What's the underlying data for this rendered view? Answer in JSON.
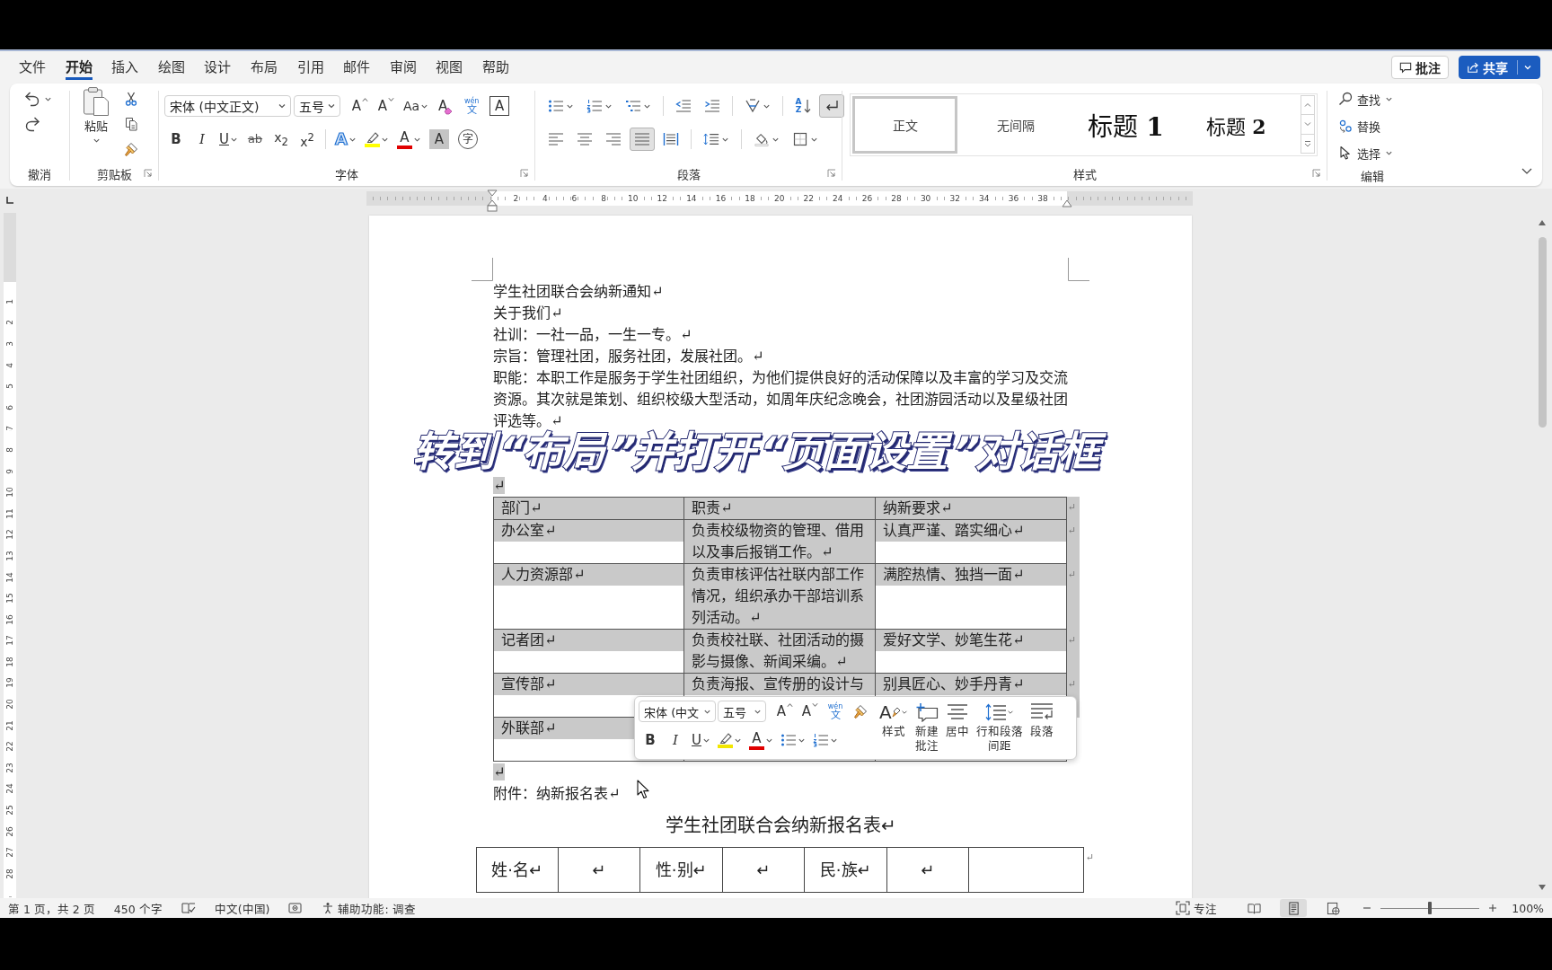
{
  "menu_tabs": [
    {
      "label": "文件",
      "selected": false
    },
    {
      "label": "开始",
      "selected": true
    },
    {
      "label": "插入",
      "selected": false
    },
    {
      "label": "绘图",
      "selected": false
    },
    {
      "label": "设计",
      "selected": false
    },
    {
      "label": "布局",
      "selected": false
    },
    {
      "label": "引用",
      "selected": false
    },
    {
      "label": "邮件",
      "selected": false
    },
    {
      "label": "审阅",
      "selected": false
    },
    {
      "label": "视图",
      "selected": false
    },
    {
      "label": "帮助",
      "selected": false
    }
  ],
  "header_buttons": [
    {
      "kind": "comments",
      "label": "批注"
    },
    {
      "kind": "share",
      "label": "共享"
    }
  ],
  "ribbon": {
    "undo": {
      "label": "撤消"
    },
    "clipboard": {
      "label": "剪贴板",
      "paste": "粘贴"
    },
    "font": {
      "label": "字体",
      "font_name": "宋体 (中文正文)",
      "font_size": "五号",
      "row1": [
        {
          "kind": "grow",
          "glyph": "A"
        },
        {
          "kind": "shrink",
          "glyph": "A"
        },
        {
          "kind": "case",
          "glyph": "Aa"
        },
        {
          "kind": "clear",
          "glyph": "A"
        },
        {
          "kind": "phonetic",
          "glyph": "wén",
          "base": "文"
        },
        {
          "kind": "border",
          "glyph": "A"
        }
      ],
      "row2": [
        {
          "kind": "bold",
          "glyph": "B"
        },
        {
          "kind": "italic",
          "glyph": "I"
        },
        {
          "kind": "underline",
          "glyph": "U"
        },
        {
          "kind": "strike",
          "glyph": "ab"
        },
        {
          "kind": "subscript",
          "glyph": "x$_{2}$"
        },
        {
          "kind": "superscript",
          "glyph": "x$^{2}$"
        },
        {
          "kind": "effects",
          "glyph": "A"
        },
        {
          "kind": "highlight",
          "color": "#ffff00"
        },
        {
          "kind": "color",
          "glyph": "A",
          "color": "#e00000"
        },
        {
          "kind": "char_shading",
          "glyph": "A"
        },
        {
          "kind": "enclose",
          "glyph": "字"
        }
      ]
    },
    "paragraph": {
      "label": "段落",
      "row1": [
        {
          "kind": "bullets",
          "pressed": false
        },
        {
          "kind": "numbering",
          "pressed": false
        },
        {
          "kind": "multilevel",
          "pressed": false
        },
        {
          "kind": "outdent",
          "pressed": false
        },
        {
          "kind": "indent",
          "pressed": false
        },
        {
          "kind": "asian",
          "pressed": false
        },
        {
          "kind": "sort",
          "glyph": "A Z",
          "pressed": false
        },
        {
          "kind": "marks",
          "pressed": true
        }
      ],
      "row2": [
        {
          "kind": "left",
          "pressed": false
        },
        {
          "kind": "center",
          "pressed": false
        },
        {
          "kind": "right",
          "pressed": false
        },
        {
          "kind": "justify",
          "pressed": true
        },
        {
          "kind": "distributed",
          "pressed": false
        },
        {
          "kind": "spacing",
          "pressed": false
        },
        {
          "kind": "shading",
          "pressed": false
        },
        {
          "kind": "borders",
          "pressed": false
        }
      ]
    },
    "styles": {
      "label": "样式",
      "items": [
        {
          "kind": "normal",
          "label": "正文",
          "selected": true
        },
        {
          "kind": "normal",
          "label": "无间隔",
          "selected": false
        },
        {
          "kind": "heading1",
          "label": "标题 **1**",
          "selected": false
        },
        {
          "kind": "heading2",
          "label": "标题 **2**",
          "selected": false
        }
      ]
    },
    "editing": {
      "label": "编辑",
      "items": [
        {
          "kind": "find",
          "label": "查找"
        },
        {
          "kind": "replace",
          "label": "替换"
        },
        {
          "kind": "select",
          "label": "选择"
        }
      ]
    }
  },
  "ruler": {
    "numbers": [
      "2",
      "4",
      "6",
      "8",
      "10",
      "12",
      "14",
      "16",
      "18",
      "20",
      "22",
      "24",
      "26",
      "28",
      "30",
      "32",
      "34",
      "36",
      "38"
    ]
  },
  "vertical_ruler": {
    "numbers": [
      "1",
      "2",
      "3",
      "4",
      "5",
      "6",
      "7",
      "8",
      "9",
      "10",
      "11",
      "12",
      "13",
      "14",
      "15",
      "16",
      "17",
      "18",
      "19",
      "20",
      "21",
      "22",
      "23",
      "24",
      "25",
      "26",
      "27",
      "28"
    ]
  },
  "document": {
    "body": [
      {
        "kind": "paragraph",
        "text": "学生社团联合会纳新通知↵",
        "selected": false
      },
      {
        "kind": "paragraph",
        "text": "关于我们↵",
        "selected": false
      },
      {
        "kind": "paragraph",
        "text": "社训：一社一品，一生一专。↵",
        "selected": false
      },
      {
        "kind": "paragraph",
        "text": "宗旨：管理社团，服务社团，发展社团。↵",
        "selected": false
      },
      {
        "kind": "paragraph",
        "text": "职能：本职工作是服务于学生社团组织，为他们提供良好的活动保障以及丰富的学习及交流资源。其次就是策划、组织校级大型活动，如周年庆纪念晚会，社团游园活动以及星级社团评选等。↵",
        "selected": false
      },
      {
        "kind": "covered"
      },
      {
        "kind": "paragraph",
        "text": "↵",
        "selected": true
      },
      {
        "kind": "table",
        "selected": true,
        "columns": [
          "部门↵",
          "职责↵",
          "纳新要求↵"
        ],
        "header_end": "↵",
        "rows": [
          {
            "cells": [
              "办公室↵",
              "负责校级物资的管理、借用以及事后报销工作。↵",
              "认真严谨、踏实细心↵"
            ],
            "end": "↵"
          },
          {
            "cells": [
              "人力资源部↵",
              "负责审核评估社联内部工作情况，组织承办干部培训系列活动。↵",
              "满腔热情、独挡一面↵"
            ],
            "end": "↵"
          },
          {
            "cells": [
              "记者团↵",
              "负责校社联、社团活动的摄影与摄像、新闻采编。↵",
              "爱好文学、妙笔生花↵"
            ],
            "end": "↵"
          },
          {
            "cells": [
              "宣传部↵",
              "负责海报、宣传册的设计与",
              "别具匠心、妙手丹青↵"
            ],
            "end": "↵"
          },
          {
            "cells": [
              "外联部↵"
            ]
          }
        ]
      },
      {
        "kind": "paragraph",
        "text": "↵",
        "selected": true
      },
      {
        "kind": "paragraph",
        "text": "附件：纳新报名表↵",
        "selected": false
      },
      {
        "kind": "title",
        "text": "学生社团联合会纳新报名表↵"
      },
      {
        "kind": "form",
        "cells": [
          "姓·名↵",
          "↵",
          "性·别↵",
          "↵",
          "民·族↵",
          "↵"
        ],
        "end": "↵"
      }
    ]
  },
  "mini_toolbar": {
    "font_name": "宋体 (中文",
    "font_size": "五号",
    "row1": [
      {
        "kind": "grow",
        "glyph": "A"
      },
      {
        "kind": "shrink",
        "glyph": "A"
      },
      {
        "kind": "phonetic",
        "glyph": "wén",
        "base": "文"
      },
      {
        "kind": "painter"
      }
    ],
    "row2": [
      {
        "kind": "bold",
        "glyph": "B"
      },
      {
        "kind": "italic",
        "glyph": "I"
      },
      {
        "kind": "underline",
        "glyph": "U"
      },
      {
        "kind": "highlight",
        "color": "#f2e600"
      },
      {
        "kind": "color",
        "glyph": "A",
        "color": "#e00000"
      },
      {
        "kind": "bullets"
      },
      {
        "kind": "numbering"
      }
    ],
    "big": [
      {
        "kind": "styles",
        "glyph": "A",
        "label": "样式"
      },
      {
        "kind": "comment",
        "label": "新建批注"
      },
      {
        "kind": "center",
        "label": "居中"
      },
      {
        "kind": "spacing",
        "label": "行和段落间距"
      },
      {
        "kind": "paragraph",
        "label": "段落"
      }
    ]
  },
  "caption": {
    "text": "转到“布局”并打开“页面设置”对话框"
  },
  "status_bar": {
    "left": [
      {
        "kind": "pages",
        "text": "第 1 页，共 2 页"
      },
      {
        "kind": "words",
        "text": "450 个字"
      },
      {
        "kind": "proofing"
      },
      {
        "kind": "language",
        "text": "中文(中国)"
      },
      {
        "kind": "macro"
      },
      {
        "kind": "accessibility",
        "text": "辅助功能: 调查"
      }
    ],
    "focus": "专注",
    "views": [
      {
        "kind": "read",
        "selected": false
      },
      {
        "kind": "print",
        "selected": true
      },
      {
        "kind": "web",
        "selected": false
      }
    ],
    "zoom": {
      "level": 0.5,
      "text": "100%"
    }
  }
}
